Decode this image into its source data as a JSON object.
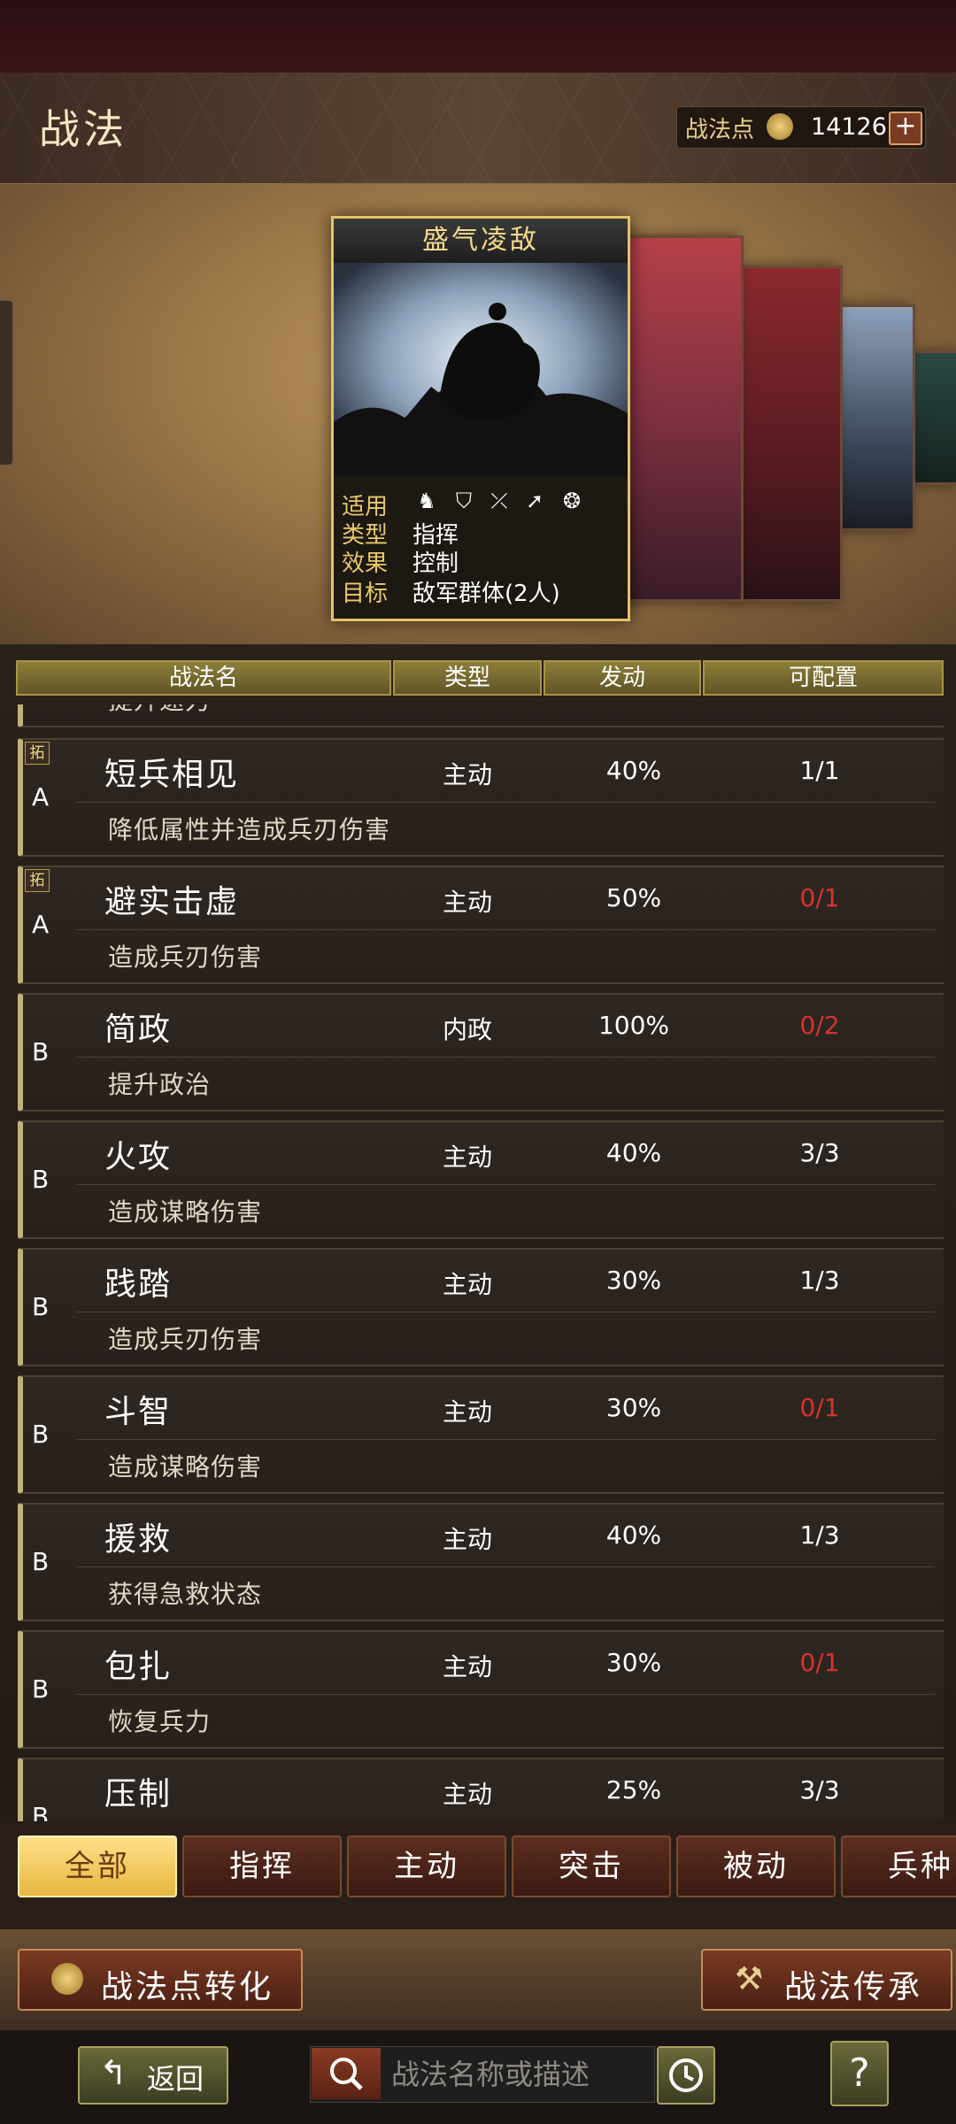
{
  "header": {
    "title": "战法",
    "points_label": "战法点",
    "points_value": "14126",
    "add_label": "+"
  },
  "featured_card": {
    "name": "盛气凌敌",
    "labels": [
      "适用",
      "类型",
      "效果",
      "目标"
    ],
    "type": "指挥",
    "effect": "控制",
    "target": "敌军群体(2人)",
    "unit_icons": [
      "cavalry-icon",
      "shield-icon",
      "bow-icon",
      "spear-icon",
      "siege-icon"
    ]
  },
  "table": {
    "columns": [
      "战法名",
      "类型",
      "发动",
      "可配置"
    ],
    "partial_top_desc": "提升速力",
    "rows": [
      {
        "grade": "A",
        "tag": "拓",
        "name": "短兵相见",
        "type": "主动",
        "trigger": "40%",
        "config": "1/1",
        "config_color": "white",
        "desc": "降低属性并造成兵刃伤害"
      },
      {
        "grade": "A",
        "tag": "拓",
        "name": "避实击虚",
        "type": "主动",
        "trigger": "50%",
        "config": "0/1",
        "config_color": "red",
        "desc": "造成兵刃伤害"
      },
      {
        "grade": "B",
        "tag": "",
        "name": "简政",
        "type": "内政",
        "trigger": "100%",
        "config": "0/2",
        "config_color": "red",
        "desc": "提升政治"
      },
      {
        "grade": "B",
        "tag": "",
        "name": "火攻",
        "type": "主动",
        "trigger": "40%",
        "config": "3/3",
        "config_color": "white",
        "desc": "造成谋略伤害"
      },
      {
        "grade": "B",
        "tag": "",
        "name": "践踏",
        "type": "主动",
        "trigger": "30%",
        "config": "1/3",
        "config_color": "white",
        "desc": "造成兵刃伤害"
      },
      {
        "grade": "B",
        "tag": "",
        "name": "斗智",
        "type": "主动",
        "trigger": "30%",
        "config": "0/1",
        "config_color": "red",
        "desc": "造成谋略伤害"
      },
      {
        "grade": "B",
        "tag": "",
        "name": "援救",
        "type": "主动",
        "trigger": "40%",
        "config": "1/3",
        "config_color": "white",
        "desc": "获得急救状态"
      },
      {
        "grade": "B",
        "tag": "",
        "name": "包扎",
        "type": "主动",
        "trigger": "30%",
        "config": "0/1",
        "config_color": "red",
        "desc": "恢复兵力"
      },
      {
        "grade": "B",
        "tag": "",
        "name": "压制",
        "type": "主动",
        "trigger": "25%",
        "config": "3/3",
        "config_color": "white",
        "desc": ""
      }
    ]
  },
  "filter_tabs": [
    "全部",
    "指挥",
    "主动",
    "突击",
    "被动",
    "兵种"
  ],
  "active_tab": 0,
  "buttons": {
    "convert": "战法点转化",
    "inherit": "战法传承",
    "back": "返回",
    "help": "?"
  },
  "search": {
    "placeholder": "战法名称或描述"
  },
  "colors": {
    "gold": "#e9c96b",
    "red_count": "#d6342e",
    "active_tab": "#e6b740"
  }
}
